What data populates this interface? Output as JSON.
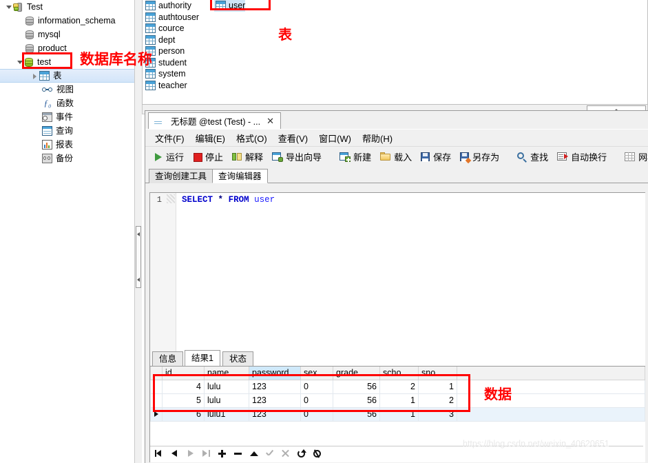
{
  "tree": {
    "root": {
      "label": "Test",
      "icon": "connection-icon",
      "expanded": true
    },
    "databases": [
      {
        "label": "information_schema",
        "icon": "database-icon",
        "active": false
      },
      {
        "label": "mysql",
        "icon": "database-icon",
        "active": false
      },
      {
        "label": "product",
        "icon": "database-icon",
        "active": false
      },
      {
        "label": "test",
        "icon": "database-icon",
        "active": true
      }
    ],
    "test_children": [
      {
        "label": "表",
        "icon": "table-icon",
        "selected": true,
        "expander": "closed"
      },
      {
        "label": "视图",
        "icon": "view-icon",
        "selected": false
      },
      {
        "label": "函数",
        "icon": "function-icon",
        "selected": false
      },
      {
        "label": "事件",
        "icon": "event-icon",
        "selected": false
      },
      {
        "label": "查询",
        "icon": "query-icon",
        "selected": false
      },
      {
        "label": "报表",
        "icon": "report-icon",
        "selected": false
      },
      {
        "label": "备份",
        "icon": "backup-icon",
        "selected": false
      }
    ]
  },
  "objects": {
    "column1": [
      {
        "label": "authority",
        "icon": "table-icon",
        "selected": false
      },
      {
        "label": "authtouser",
        "icon": "table-icon",
        "selected": false
      },
      {
        "label": "cource",
        "icon": "table-icon",
        "selected": false
      },
      {
        "label": "dept",
        "icon": "table-icon",
        "selected": false
      },
      {
        "label": "person",
        "icon": "table-icon",
        "selected": false
      },
      {
        "label": "student",
        "icon": "table-icon",
        "selected": false
      },
      {
        "label": "system",
        "icon": "table-icon",
        "selected": false
      },
      {
        "label": "teacher",
        "icon": "table-icon",
        "selected": false
      }
    ],
    "column2": [
      {
        "label": "user",
        "icon": "table-icon",
        "selected": true
      }
    ]
  },
  "query_window": {
    "tab": {
      "title": "无标题 @test (Test) - ...",
      "close": "✕"
    },
    "menu": [
      {
        "label": "文件(F)",
        "accel": "F"
      },
      {
        "label": "编辑(E)",
        "accel": "E"
      },
      {
        "label": "格式(O)",
        "accel": "O"
      },
      {
        "label": "查看(V)",
        "accel": "V"
      },
      {
        "label": "窗口(W)",
        "accel": "W"
      },
      {
        "label": "帮助(H)",
        "accel": "H"
      }
    ],
    "toolbar": [
      {
        "label": "运行",
        "icon": "run-icon"
      },
      {
        "label": "停止",
        "icon": "stop-icon"
      },
      {
        "label": "解释",
        "icon": "explain-icon"
      },
      {
        "label": "导出向导",
        "icon": "export-wizard-icon"
      },
      {
        "label": "新建",
        "icon": "new-icon"
      },
      {
        "label": "载入",
        "icon": "open-icon"
      },
      {
        "label": "保存",
        "icon": "save-icon"
      },
      {
        "label": "另存为",
        "icon": "save-as-icon"
      },
      {
        "label": "查找",
        "icon": "find-icon"
      },
      {
        "label": "自动换行",
        "icon": "wrap-icon"
      },
      {
        "label": "网格查看",
        "icon": "grid-view-icon"
      }
    ],
    "inner_tabs": [
      {
        "label": "查询创建工具",
        "active": false
      },
      {
        "label": "查询编辑器",
        "active": true
      }
    ],
    "editor": {
      "line_number": "1",
      "sql_tokens": [
        {
          "text": "SELECT",
          "type": "keyword"
        },
        {
          "text": " ",
          "type": "plain"
        },
        {
          "text": "*",
          "type": "operator"
        },
        {
          "text": " ",
          "type": "plain"
        },
        {
          "text": "FROM",
          "type": "keyword"
        },
        {
          "text": " ",
          "type": "plain"
        },
        {
          "text": "user",
          "type": "table"
        }
      ]
    },
    "result_tabs": [
      {
        "label": "信息",
        "active": false
      },
      {
        "label": "结果1",
        "active": true
      },
      {
        "label": "状态",
        "active": false
      }
    ],
    "grid": {
      "columns": [
        "id",
        "name",
        "password",
        "sex",
        "grade",
        "scho",
        "sno"
      ],
      "highlighted_column": "password",
      "rows": [
        {
          "id": "4",
          "name": "lulu",
          "password": "123",
          "sex": "0",
          "grade": "56",
          "scho": "2",
          "sno": "1",
          "current": false
        },
        {
          "id": "5",
          "name": "lulu",
          "password": "123",
          "sex": "0",
          "grade": "56",
          "scho": "1",
          "sno": "2",
          "current": false
        },
        {
          "id": "6",
          "name": "lulu1",
          "password": "123",
          "sex": "0",
          "grade": "56",
          "scho": "1",
          "sno": "3",
          "current": true
        }
      ]
    },
    "navbar": [
      {
        "name": "first-record-button",
        "enabled": true
      },
      {
        "name": "previous-record-button",
        "enabled": true
      },
      {
        "name": "next-record-button",
        "enabled": false
      },
      {
        "name": "last-record-button",
        "enabled": false
      },
      {
        "name": "add-record-button",
        "enabled": true
      },
      {
        "name": "delete-record-button",
        "enabled": true
      },
      {
        "name": "edit-record-button",
        "enabled": true
      },
      {
        "name": "apply-changes-button",
        "enabled": false
      },
      {
        "name": "cancel-changes-button",
        "enabled": false
      },
      {
        "name": "refresh-button",
        "enabled": true
      },
      {
        "name": "stop-button",
        "enabled": true
      }
    ]
  },
  "annotations": [
    {
      "name": "database-name-annotation",
      "text": "数据库名称"
    },
    {
      "name": "tables-annotation",
      "text": "表"
    },
    {
      "name": "data-annotation",
      "text": "数据"
    }
  ],
  "watermark": "https://blog.csdn.net/weixin_40620651",
  "colors": {
    "annotation_red": "#ff0000",
    "selection_blue": "#cfe4f7",
    "header_highlight": "#cfe9fa",
    "sql_keyword": "#0000cc"
  }
}
